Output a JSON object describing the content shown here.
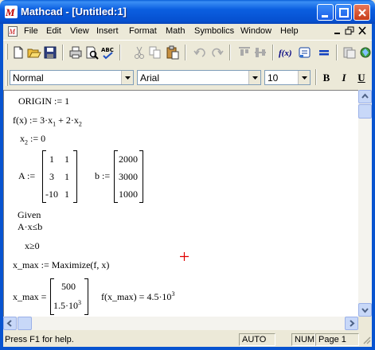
{
  "window": {
    "title": "Mathcad - [Untitled:1]"
  },
  "menubar": {
    "items": [
      "File",
      "Edit",
      "View",
      "Insert",
      "Format",
      "Math",
      "Symbolics",
      "Window",
      "Help"
    ]
  },
  "format_toolbar": {
    "style": "Normal",
    "font": "Arial",
    "size": "10",
    "bold": "B",
    "italic": "I",
    "underline": "U"
  },
  "worksheet": {
    "origin": {
      "lhs": "ORIGIN",
      "op": ":=",
      "rhs": "1"
    },
    "fdef": {
      "lhs": "f(x)",
      "op": ":=",
      "rhs_a": "3·x",
      "sub1": "1",
      "rhs_b": "+ 2·x",
      "sub2": "2"
    },
    "x2": {
      "lhs": "x",
      "sub": "2",
      "op": ":=",
      "rhs": "0"
    },
    "A": {
      "lhs": "A",
      "op": ":=",
      "rows": [
        [
          "1",
          "1"
        ],
        [
          "3",
          "1"
        ],
        [
          "-10",
          "1"
        ]
      ]
    },
    "b": {
      "lhs": "b",
      "op": ":=",
      "rows": [
        "2000",
        "3000",
        "1000"
      ]
    },
    "given": "Given",
    "constraint1": "A·x≤b",
    "constraint2": "x≥0",
    "maximize": {
      "lhs": "x_max",
      "op": ":=",
      "rhs": "Maximize(f, x)"
    },
    "result": {
      "lhs": "x_max",
      "op": "=",
      "rows": [
        "500",
        "1.5·10"
      ],
      "row2_exp": "3"
    },
    "fresult": {
      "lhs": "f(x_max)",
      "op": "=",
      "rhs": "4.5·10",
      "exp": "3"
    }
  },
  "statusbar": {
    "help": "Press F1 for help.",
    "mode": "AUTO",
    "num": "NUM",
    "page": "Page 1"
  },
  "colors": {
    "titlebar": "#0a5fe0",
    "cursor": "#e00000"
  }
}
